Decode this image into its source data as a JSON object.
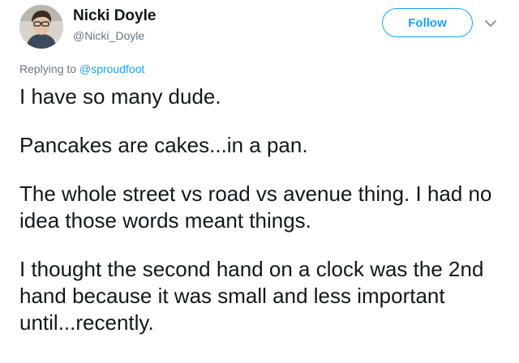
{
  "author": {
    "display_name": "Nicki Doyle",
    "handle": "@Nicki_Doyle",
    "avatar_icon": "user-avatar"
  },
  "actions": {
    "follow_label": "Follow",
    "menu_icon": "chevron-down-icon",
    "accent_color": "#1da1f2"
  },
  "reply": {
    "prefix": "Replying to ",
    "mention": "@sproudfoot"
  },
  "tweet": {
    "paragraphs": [
      "I have so many dude.",
      "Pancakes are cakes...in a pan.",
      "The whole street vs road vs avenue thing. I had no idea those words meant things.",
      "I thought the second hand on a clock was the 2nd hand because it was small and less important until...recently."
    ]
  }
}
